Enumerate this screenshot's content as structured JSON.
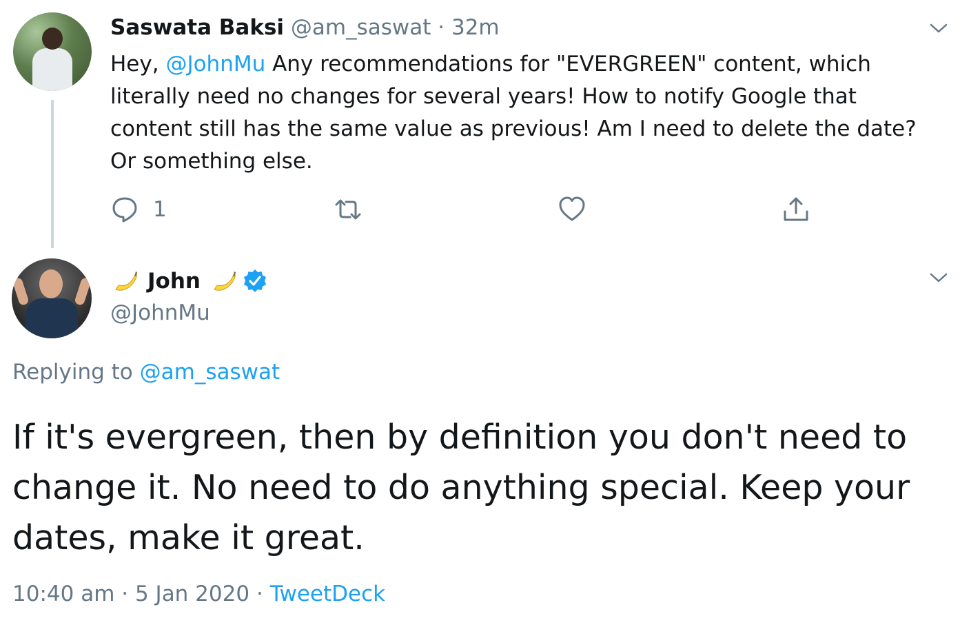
{
  "tweet1": {
    "display_name": "Saswata Baksi",
    "handle": "@am_saswat",
    "separator": "·",
    "time": "32m",
    "text_before": "Hey, ",
    "mention": "@JohnMu",
    "text_after": " Any recommendations for \"EVERGREEN\" content, which literally need no changes for several years! How to notify Google that content still has the same value as previous! Am I need to delete the date? Or something else.",
    "reply_count": "1",
    "icons": [
      "reply-icon",
      "retweet-icon",
      "like-icon",
      "share-icon",
      "chevron-down-icon"
    ]
  },
  "tweet2": {
    "display_name": "John",
    "handle": "@JohnMu",
    "verified": true,
    "emoji": "banana",
    "replying_label": "Replying to ",
    "replying_to": "@am_saswat",
    "text": "If it's evergreen, then by definition you don't need to change it. No need to do anything special. Keep your dates, make it great.",
    "time": "10:40 am",
    "separator": "·",
    "date": "5 Jan 2020",
    "separator2": "·",
    "source": "TweetDeck"
  },
  "colors": {
    "link": "#1da1f2",
    "muted": "#657786",
    "text": "#14171a",
    "thread_line": "#ccd6dd"
  }
}
